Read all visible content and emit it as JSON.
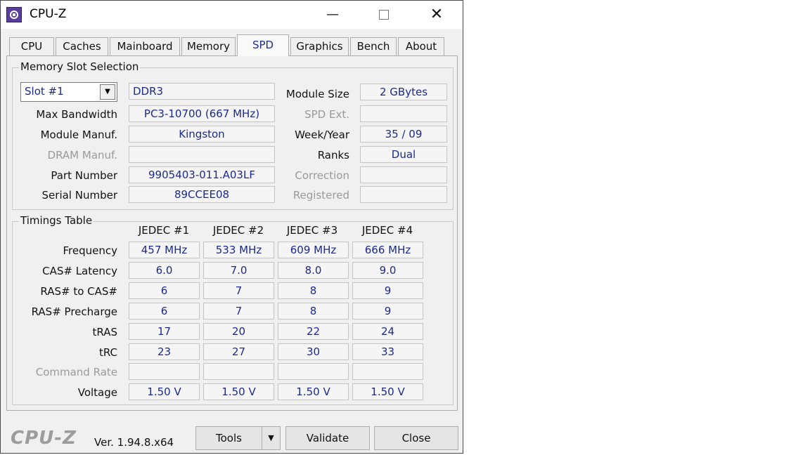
{
  "window": {
    "title": "CPU-Z"
  },
  "tabs": [
    "CPU",
    "Caches",
    "Mainboard",
    "Memory",
    "SPD",
    "Graphics",
    "Bench",
    "About"
  ],
  "active_tab": "SPD",
  "slot_group": {
    "title": "Memory Slot Selection",
    "slot_value": "Slot #1",
    "memory_type": "DDR3",
    "module_size_label": "Module Size",
    "module_size": "2 GBytes",
    "max_bandwidth_label": "Max Bandwidth",
    "max_bandwidth": "PC3-10700 (667 MHz)",
    "spd_ext_label": "SPD Ext.",
    "spd_ext": "",
    "module_manuf_label": "Module Manuf.",
    "module_manuf": "Kingston",
    "week_year_label": "Week/Year",
    "week_year": "35 / 09",
    "dram_manuf_label": "DRAM Manuf.",
    "dram_manuf": "",
    "ranks_label": "Ranks",
    "ranks": "Dual",
    "part_number_label": "Part Number",
    "part_number": "9905403-011.A03LF",
    "correction_label": "Correction",
    "correction": "",
    "serial_number_label": "Serial Number",
    "serial_number": "89CCEE08",
    "registered_label": "Registered",
    "registered": ""
  },
  "timings": {
    "title": "Timings Table",
    "columns": [
      "JEDEC #1",
      "JEDEC #2",
      "JEDEC #3",
      "JEDEC #4"
    ],
    "rows": [
      {
        "label": "Frequency",
        "values": [
          "457 MHz",
          "533 MHz",
          "609 MHz",
          "666 MHz"
        ]
      },
      {
        "label": "CAS# Latency",
        "values": [
          "6.0",
          "7.0",
          "8.0",
          "9.0"
        ]
      },
      {
        "label": "RAS# to CAS#",
        "values": [
          "6",
          "7",
          "8",
          "9"
        ]
      },
      {
        "label": "RAS# Precharge",
        "values": [
          "6",
          "7",
          "8",
          "9"
        ]
      },
      {
        "label": "tRAS",
        "values": [
          "17",
          "20",
          "22",
          "24"
        ]
      },
      {
        "label": "tRC",
        "values": [
          "23",
          "27",
          "30",
          "33"
        ]
      },
      {
        "label": "Command Rate",
        "values": [
          "",
          "",
          "",
          ""
        ]
      },
      {
        "label": "Voltage",
        "values": [
          "1.50 V",
          "1.50 V",
          "1.50 V",
          "1.50 V"
        ]
      }
    ]
  },
  "footer": {
    "logo": "CPU-Z",
    "version": "Ver. 1.94.8.x64",
    "tools_label": "Tools",
    "validate_label": "Validate",
    "close_label": "Close"
  }
}
